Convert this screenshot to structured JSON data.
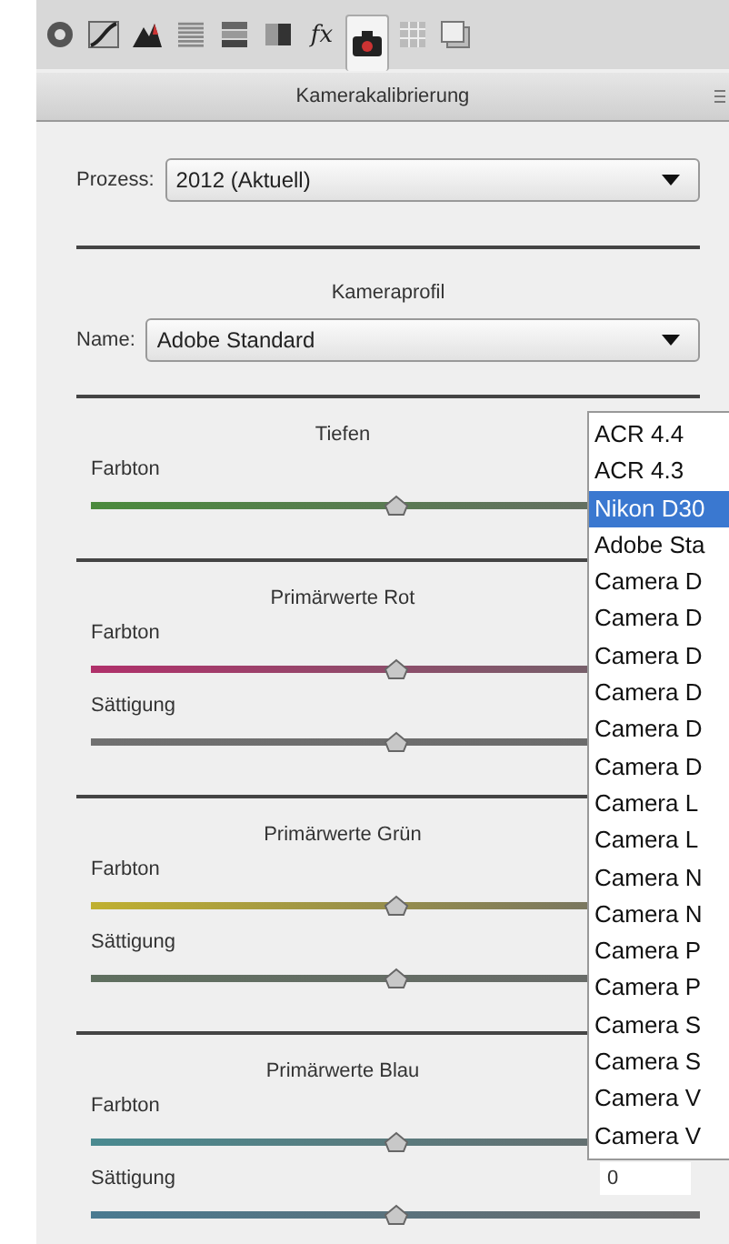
{
  "toolbar": {
    "tabs": [
      {
        "kind": "aperture",
        "selected": false
      },
      {
        "kind": "curve",
        "selected": false
      },
      {
        "kind": "mountain",
        "selected": false
      },
      {
        "kind": "lines",
        "selected": false
      },
      {
        "kind": "bars",
        "selected": false
      },
      {
        "kind": "split",
        "selected": false
      },
      {
        "kind": "fx",
        "label": "fx",
        "selected": false
      },
      {
        "kind": "camera",
        "selected": true
      },
      {
        "kind": "grid",
        "selected": false
      },
      {
        "kind": "pages",
        "selected": false
      }
    ]
  },
  "panel": {
    "title": "Kamerakalibrierung"
  },
  "process": {
    "label": "Prozess:",
    "value": "2012 (Aktuell)"
  },
  "profile": {
    "title": "Kameraprofil",
    "label": "Name:",
    "value": "Adobe Standard"
  },
  "sections": [
    {
      "title": "Tiefen",
      "sliders": [
        {
          "label": "Farbton",
          "level": 0.5,
          "color": "#4a8a3c"
        }
      ]
    },
    {
      "title": "Primärwerte Rot",
      "sliders": [
        {
          "label": "Farbton",
          "level": 0.5,
          "color": "#b0306a"
        },
        {
          "label": "Sättigung",
          "level": 0.5,
          "color": "#707070"
        }
      ]
    },
    {
      "title": "Primärwerte Grün",
      "sliders": [
        {
          "label": "Farbton",
          "level": 0.5,
          "color": "#c0b030"
        },
        {
          "label": "Sättigung",
          "level": 0.5,
          "color": "#5f6f5f"
        }
      ]
    },
    {
      "title": "Primärwerte Blau",
      "sliders": [
        {
          "label": "Farbton",
          "level": 0.5,
          "color": "#4a8a90"
        },
        {
          "label": "Sättigung",
          "level": 0.5,
          "color": "#4a7a90",
          "value": "0"
        }
      ]
    }
  ],
  "profile_list": [
    {
      "label": "ACR 4.4",
      "selected": false
    },
    {
      "label": "ACR 4.3",
      "selected": false
    },
    {
      "label": "Nikon D30",
      "selected": true
    },
    {
      "label": "Adobe Sta",
      "selected": false
    },
    {
      "label": "Camera D",
      "selected": false
    },
    {
      "label": "Camera D",
      "selected": false
    },
    {
      "label": "Camera D",
      "selected": false
    },
    {
      "label": "Camera D",
      "selected": false
    },
    {
      "label": "Camera D",
      "selected": false
    },
    {
      "label": "Camera D",
      "selected": false
    },
    {
      "label": "Camera L",
      "selected": false
    },
    {
      "label": "Camera L",
      "selected": false
    },
    {
      "label": "Camera N",
      "selected": false
    },
    {
      "label": "Camera N",
      "selected": false
    },
    {
      "label": "Camera P",
      "selected": false
    },
    {
      "label": "Camera P",
      "selected": false
    },
    {
      "label": "Camera S",
      "selected": false
    },
    {
      "label": "Camera S",
      "selected": false
    },
    {
      "label": "Camera V",
      "selected": false
    },
    {
      "label": "Camera V",
      "selected": false
    }
  ]
}
